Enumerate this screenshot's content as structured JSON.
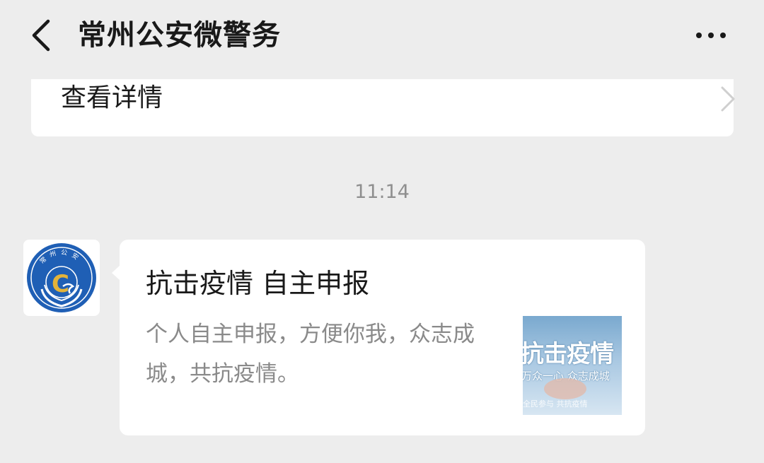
{
  "header": {
    "back_icon": "chevron-left-icon",
    "title": "常州公安微警务",
    "more_icon": "more-dots-icon"
  },
  "details_card": {
    "label": "查看详情",
    "chevron_icon": "chevron-right-icon"
  },
  "timestamp": "11:14",
  "message": {
    "avatar_icon": "police-badge-logo",
    "avatar_text": "常州公安",
    "avatar_letter": "C",
    "title": "抗击疫情 自主申报",
    "description": "个人自主申报，方便你我，众志成城，共抗疫情。",
    "thumbnail": {
      "title": "抗击疫情",
      "subtitle": "万众一心  众志成城",
      "footer": "全民参与 共抗疫情"
    }
  },
  "colors": {
    "background": "#ededed",
    "card": "#ffffff",
    "text_primary": "#191919",
    "text_secondary": "#8a8a8a",
    "badge_blue": "#1f5fb5",
    "badge_gold": "#e3b33a"
  }
}
